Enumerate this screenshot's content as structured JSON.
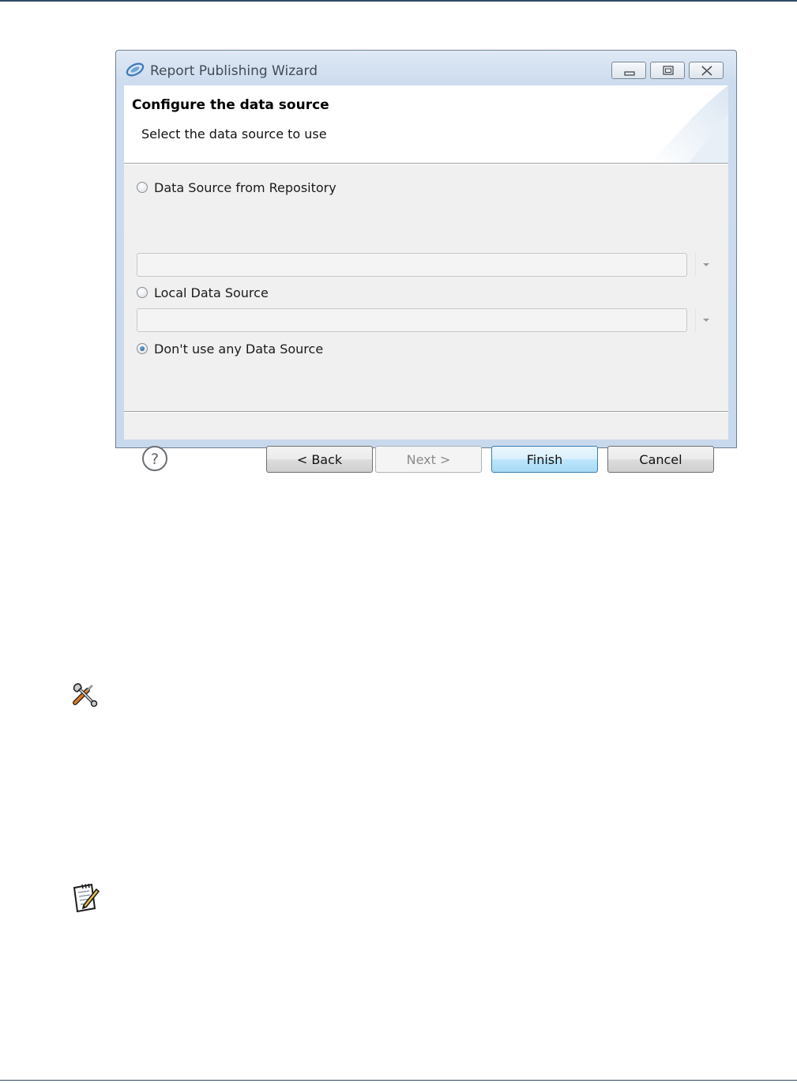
{
  "window": {
    "title": "Report Publishing Wizard",
    "controls": [
      "minimize-icon",
      "maximize-icon",
      "close-icon"
    ]
  },
  "header": {
    "title": "Configure the data source",
    "subtitle": "Select the data source to use"
  },
  "options": [
    {
      "label": "Data Source from Repository",
      "checked": false,
      "combo_value": ""
    },
    {
      "label": "Local Data Source",
      "checked": false,
      "combo_value": ""
    },
    {
      "label": "Don't use any Data Source",
      "checked": true
    }
  ],
  "buttons": {
    "back": "< Back",
    "next": "Next >",
    "finish": "Finish",
    "cancel": "Cancel"
  },
  "icons": {
    "help": "help-icon",
    "tools": "tools-icon",
    "note": "note-icon"
  },
  "colors": {
    "accent": "#3c7fb1",
    "rule": "#2f4b63"
  }
}
